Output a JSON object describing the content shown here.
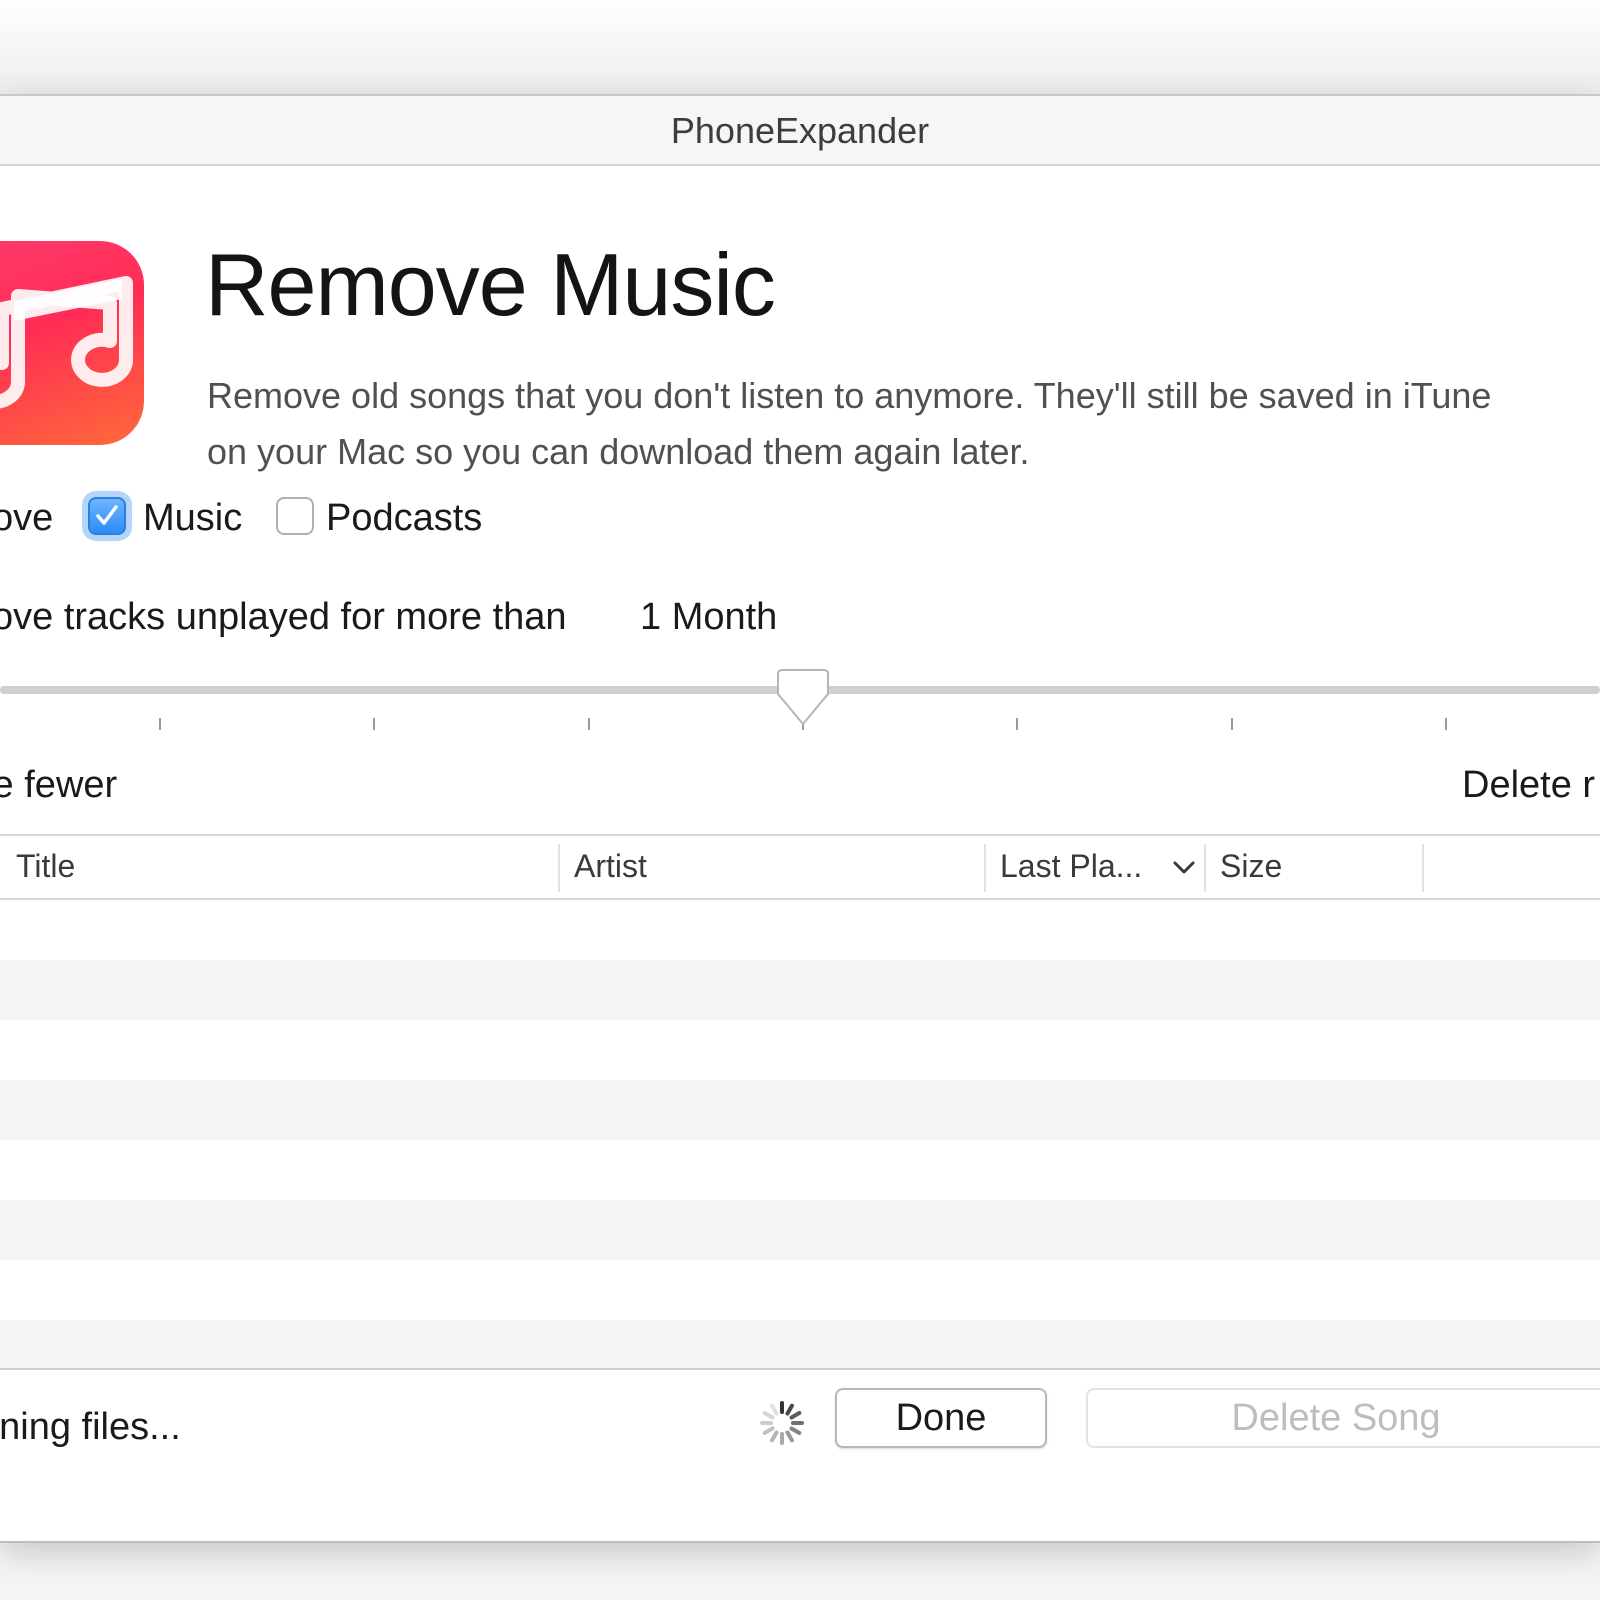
{
  "window": {
    "title": "PhoneExpander"
  },
  "header": {
    "heading": "Remove Music",
    "description_line1": "Remove old songs that you don't listen to anymore. They'll still be saved in iTune",
    "description_line2": "on your Mac so you can download them again later."
  },
  "filters": {
    "media_label": "ove",
    "music": {
      "label": "Music",
      "checked": true
    },
    "podcasts": {
      "label": "Podcasts",
      "checked": false
    },
    "unplayed_label": "ove tracks unplayed for more than",
    "unplayed_value": "1 Month"
  },
  "slider": {
    "min_label": "te fewer",
    "max_label": "Delete r",
    "tick_count": 7,
    "value_index": 3
  },
  "table": {
    "columns": [
      {
        "label": "Title"
      },
      {
        "label": "Artist"
      },
      {
        "label": "Last Pla...",
        "sorted": "descending"
      },
      {
        "label": "Size"
      }
    ],
    "rows": []
  },
  "footer": {
    "status": "nning files...",
    "done_label": "Done",
    "delete_label": "Delete Song"
  },
  "icons": {
    "app": "music-note-icon",
    "sort": "chevron-down-icon",
    "spinner": "spinner-icon",
    "check": "checkmark-icon"
  },
  "colors": {
    "icon_gradient_start": "#ff2d55",
    "icon_gradient_end": "#ff6a3a",
    "checkbox_accent": "#2f8cf5"
  }
}
